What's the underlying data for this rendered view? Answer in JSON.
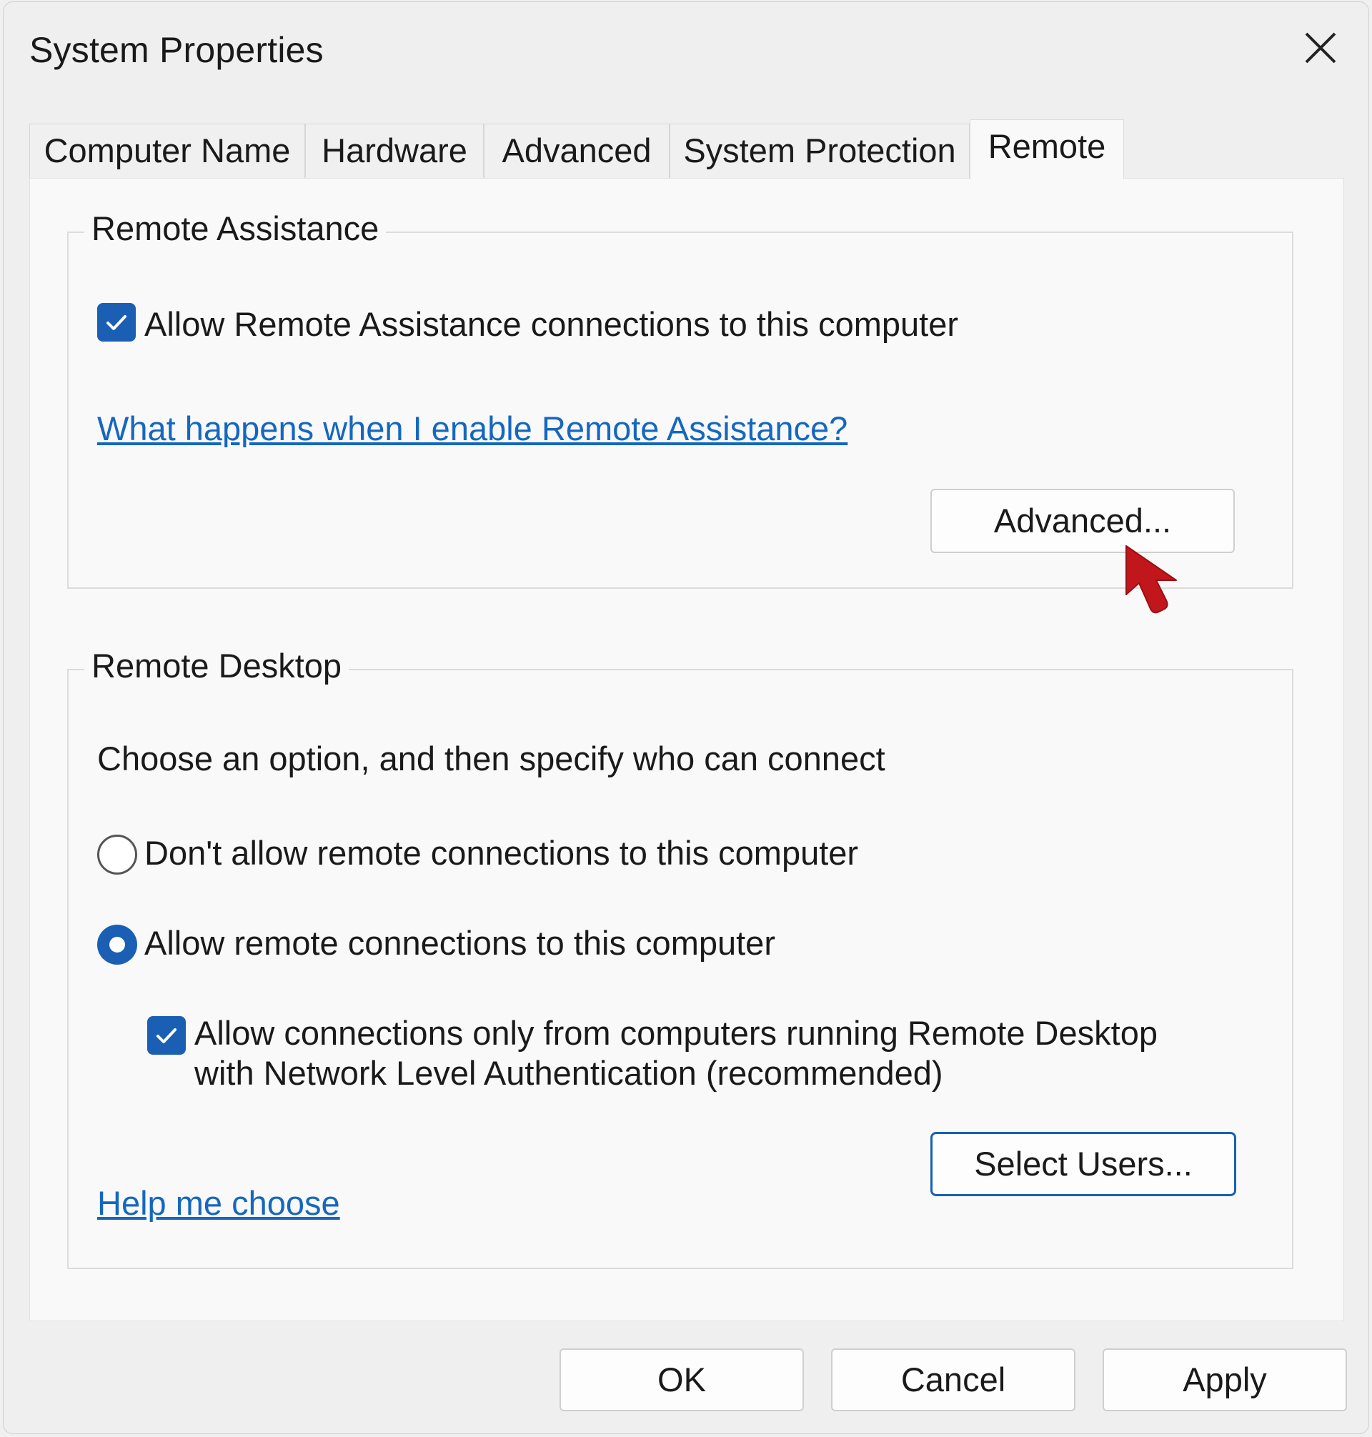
{
  "window": {
    "title": "System Properties",
    "close_icon": "close-icon"
  },
  "tabs": [
    {
      "label": "Computer Name",
      "active": false
    },
    {
      "label": "Hardware",
      "active": false
    },
    {
      "label": "Advanced",
      "active": false
    },
    {
      "label": "System Protection",
      "active": false
    },
    {
      "label": "Remote",
      "active": true
    }
  ],
  "remote_assistance": {
    "group_title": "Remote Assistance",
    "allow_checkbox": {
      "label": "Allow Remote Assistance connections to this computer",
      "checked": true
    },
    "help_link": "What happens when I enable Remote Assistance?",
    "advanced_button": "Advanced..."
  },
  "remote_desktop": {
    "group_title": "Remote Desktop",
    "instruction": "Choose an option, and then specify who can connect",
    "options": [
      {
        "label": "Don't allow remote connections to this computer",
        "selected": false
      },
      {
        "label": "Allow remote connections to this computer",
        "selected": true
      }
    ],
    "nla_checkbox": {
      "label_line1": "Allow connections only from computers running Remote Desktop",
      "label_line2": "with Network Level Authentication (recommended)",
      "checked": true
    },
    "help_link": "Help me choose",
    "select_users_button": "Select Users..."
  },
  "footer": {
    "ok": "OK",
    "cancel": "Cancel",
    "apply": "Apply"
  },
  "colors": {
    "accent": "#1a5fb4",
    "link": "#1567c0",
    "cursor": "#c0161c"
  },
  "icons": {
    "pointer": "mouse-pointer-icon",
    "check": "check-icon",
    "close": "close-icon"
  }
}
